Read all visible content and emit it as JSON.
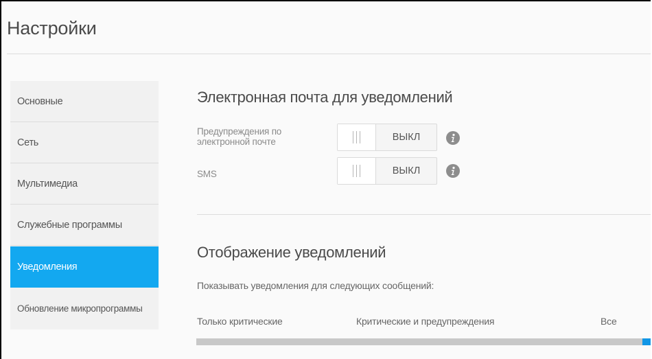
{
  "page": {
    "title": "Настройки"
  },
  "sidebar": {
    "items": [
      {
        "label": "Основные",
        "active": false
      },
      {
        "label": "Сеть",
        "active": false
      },
      {
        "label": "Мультимедиа",
        "active": false
      },
      {
        "label": "Служебные программы",
        "active": false
      },
      {
        "label": "Уведомления",
        "active": true
      },
      {
        "label": "Обновление микропрограммы",
        "active": false
      }
    ]
  },
  "email_section": {
    "title": "Электронная почта для уведомлений",
    "email_alerts": {
      "label_line1": "Предупреждения по",
      "label_line2": "электронной почте",
      "state": "ВЫКЛ"
    },
    "sms": {
      "label": "SMS",
      "state": "ВЫКЛ"
    }
  },
  "display_section": {
    "title": "Отображение уведомлений",
    "description": "Показывать уведомления для следующих сообщений:",
    "slider": {
      "options": [
        "Только критические",
        "Критические и предупреждения",
        "Все"
      ],
      "selected": "Все"
    }
  },
  "colors": {
    "accent": "#13a8f0",
    "slider_fill": "#1196e6"
  },
  "icons": {
    "info": "info-icon"
  }
}
